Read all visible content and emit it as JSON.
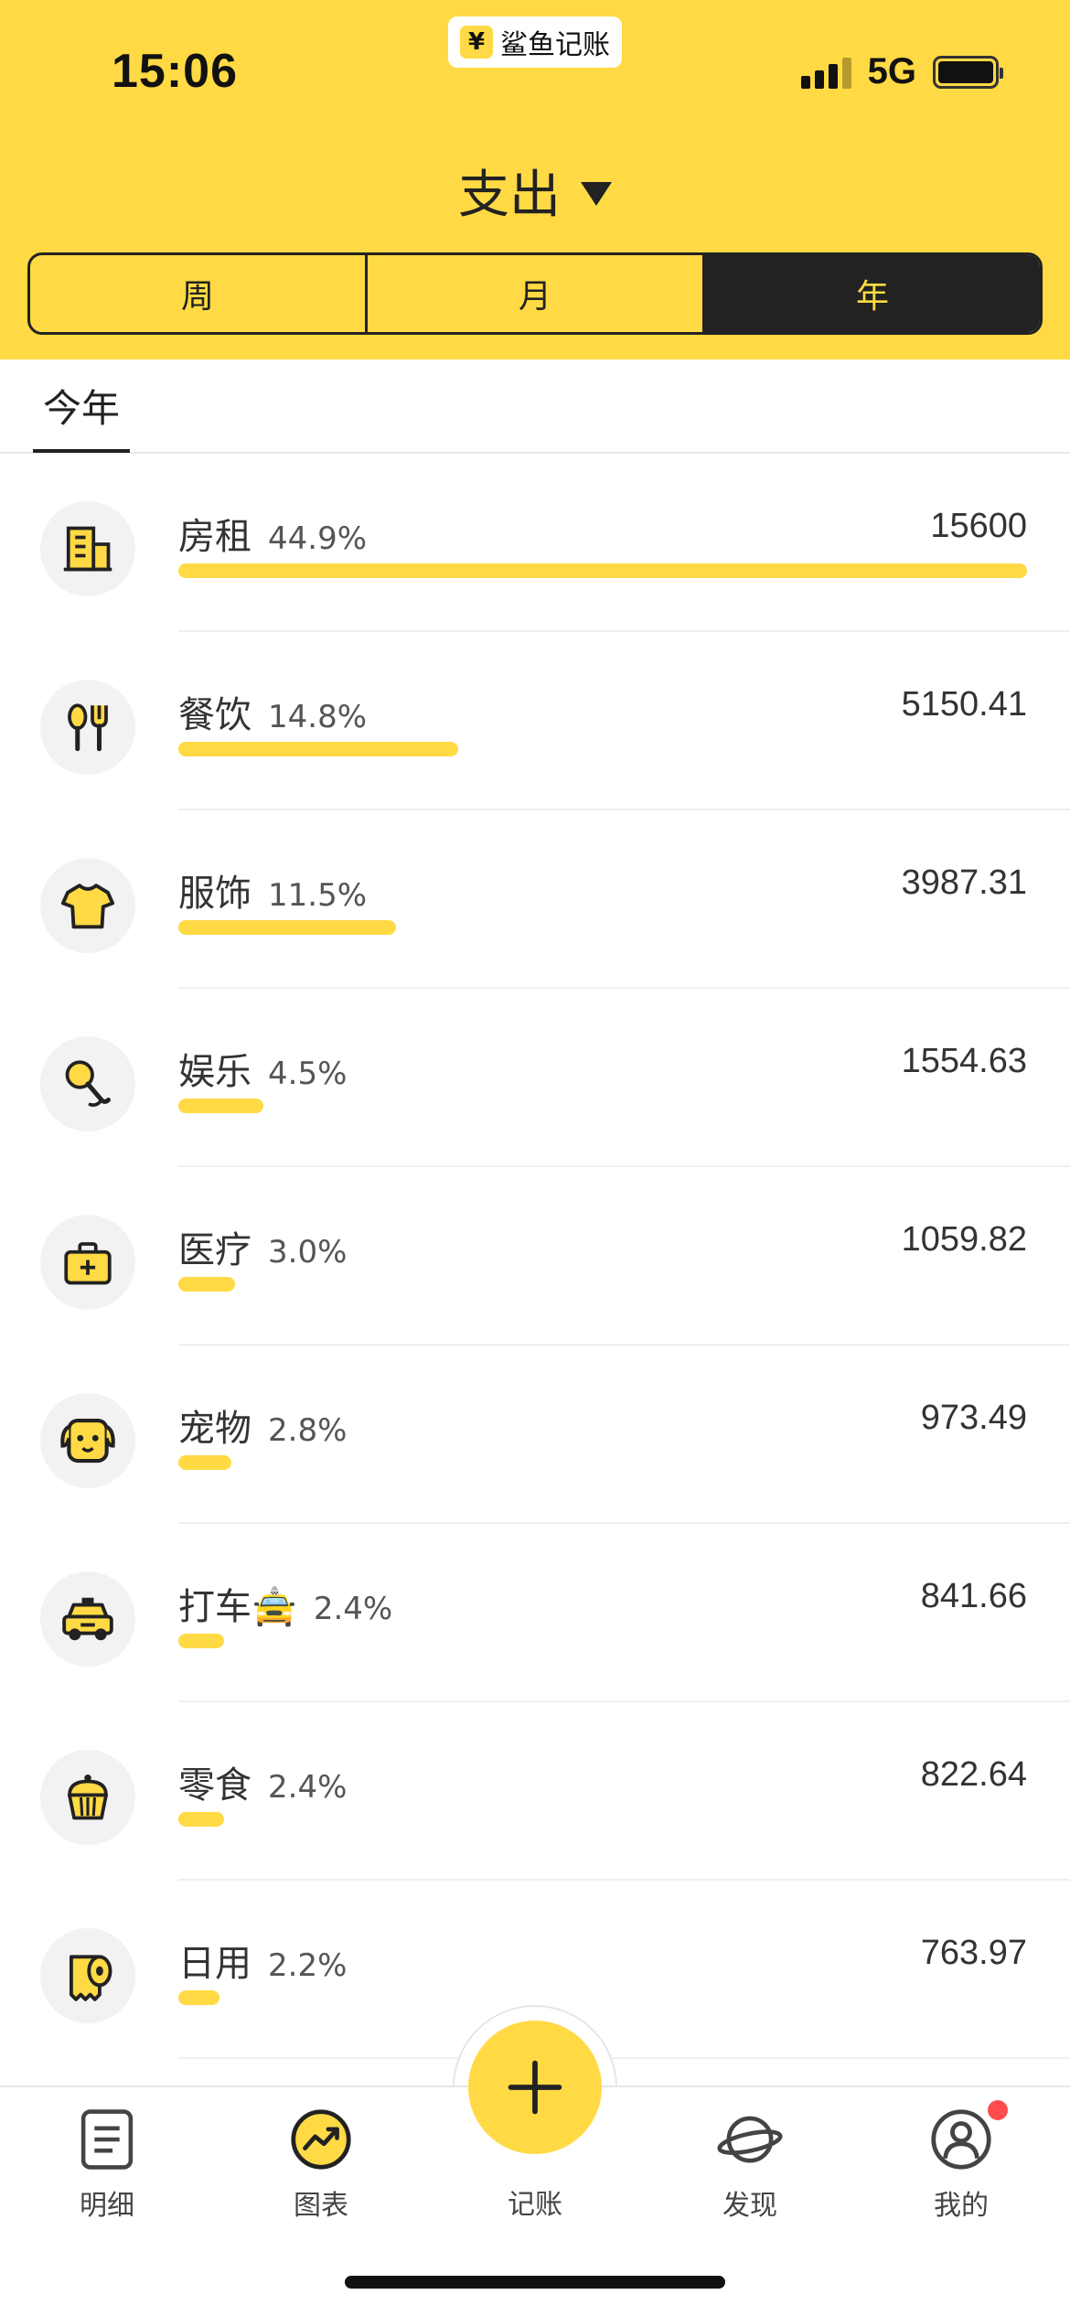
{
  "status_bar": {
    "time": "15:06",
    "app_name": "鲨鱼记账",
    "app_icon_glyph": "¥",
    "network": "5G",
    "signal_icon": "signal-bars-icon",
    "battery_icon": "battery-icon"
  },
  "header": {
    "title": "支出",
    "period_tabs": [
      {
        "label": "周",
        "active": false
      },
      {
        "label": "月",
        "active": false
      },
      {
        "label": "年",
        "active": true
      }
    ]
  },
  "sub_tabs": {
    "current": "今年"
  },
  "colors": {
    "brand_yellow": "#FFDA44",
    "dark": "#222222",
    "badge_red": "#FF4D4F"
  },
  "categories": [
    {
      "name": "房租",
      "percent": "44.9%",
      "amount": "15600",
      "share": 0.449,
      "icon": "building-icon"
    },
    {
      "name": "餐饮",
      "percent": "14.8%",
      "amount": "5150.41",
      "share": 0.148,
      "icon": "utensils-icon"
    },
    {
      "name": "服饰",
      "percent": "11.5%",
      "amount": "3987.31",
      "share": 0.115,
      "icon": "tshirt-icon"
    },
    {
      "name": "娱乐",
      "percent": "4.5%",
      "amount": "1554.63",
      "share": 0.045,
      "icon": "microphone-icon"
    },
    {
      "name": "医疗",
      "percent": "3.0%",
      "amount": "1059.82",
      "share": 0.03,
      "icon": "medical-kit-icon"
    },
    {
      "name": "宠物",
      "percent": "2.8%",
      "amount": "973.49",
      "share": 0.028,
      "icon": "pet-dog-icon"
    },
    {
      "name": "打车🚖",
      "percent": "2.4%",
      "amount": "841.66",
      "share": 0.024,
      "icon": "taxi-icon"
    },
    {
      "name": "零食",
      "percent": "2.4%",
      "amount": "822.64",
      "share": 0.024,
      "icon": "cupcake-icon"
    },
    {
      "name": "日用",
      "percent": "2.2%",
      "amount": "763.97",
      "share": 0.022,
      "icon": "toilet-paper-icon"
    }
  ],
  "bottom_nav": {
    "items": [
      {
        "label": "明细",
        "icon": "document-list-icon"
      },
      {
        "label": "图表",
        "icon": "trend-chart-icon",
        "active": true
      },
      {
        "label": "记账",
        "icon": "plus-icon"
      },
      {
        "label": "发现",
        "icon": "planet-icon"
      },
      {
        "label": "我的",
        "icon": "user-icon",
        "badge": true
      }
    ]
  }
}
